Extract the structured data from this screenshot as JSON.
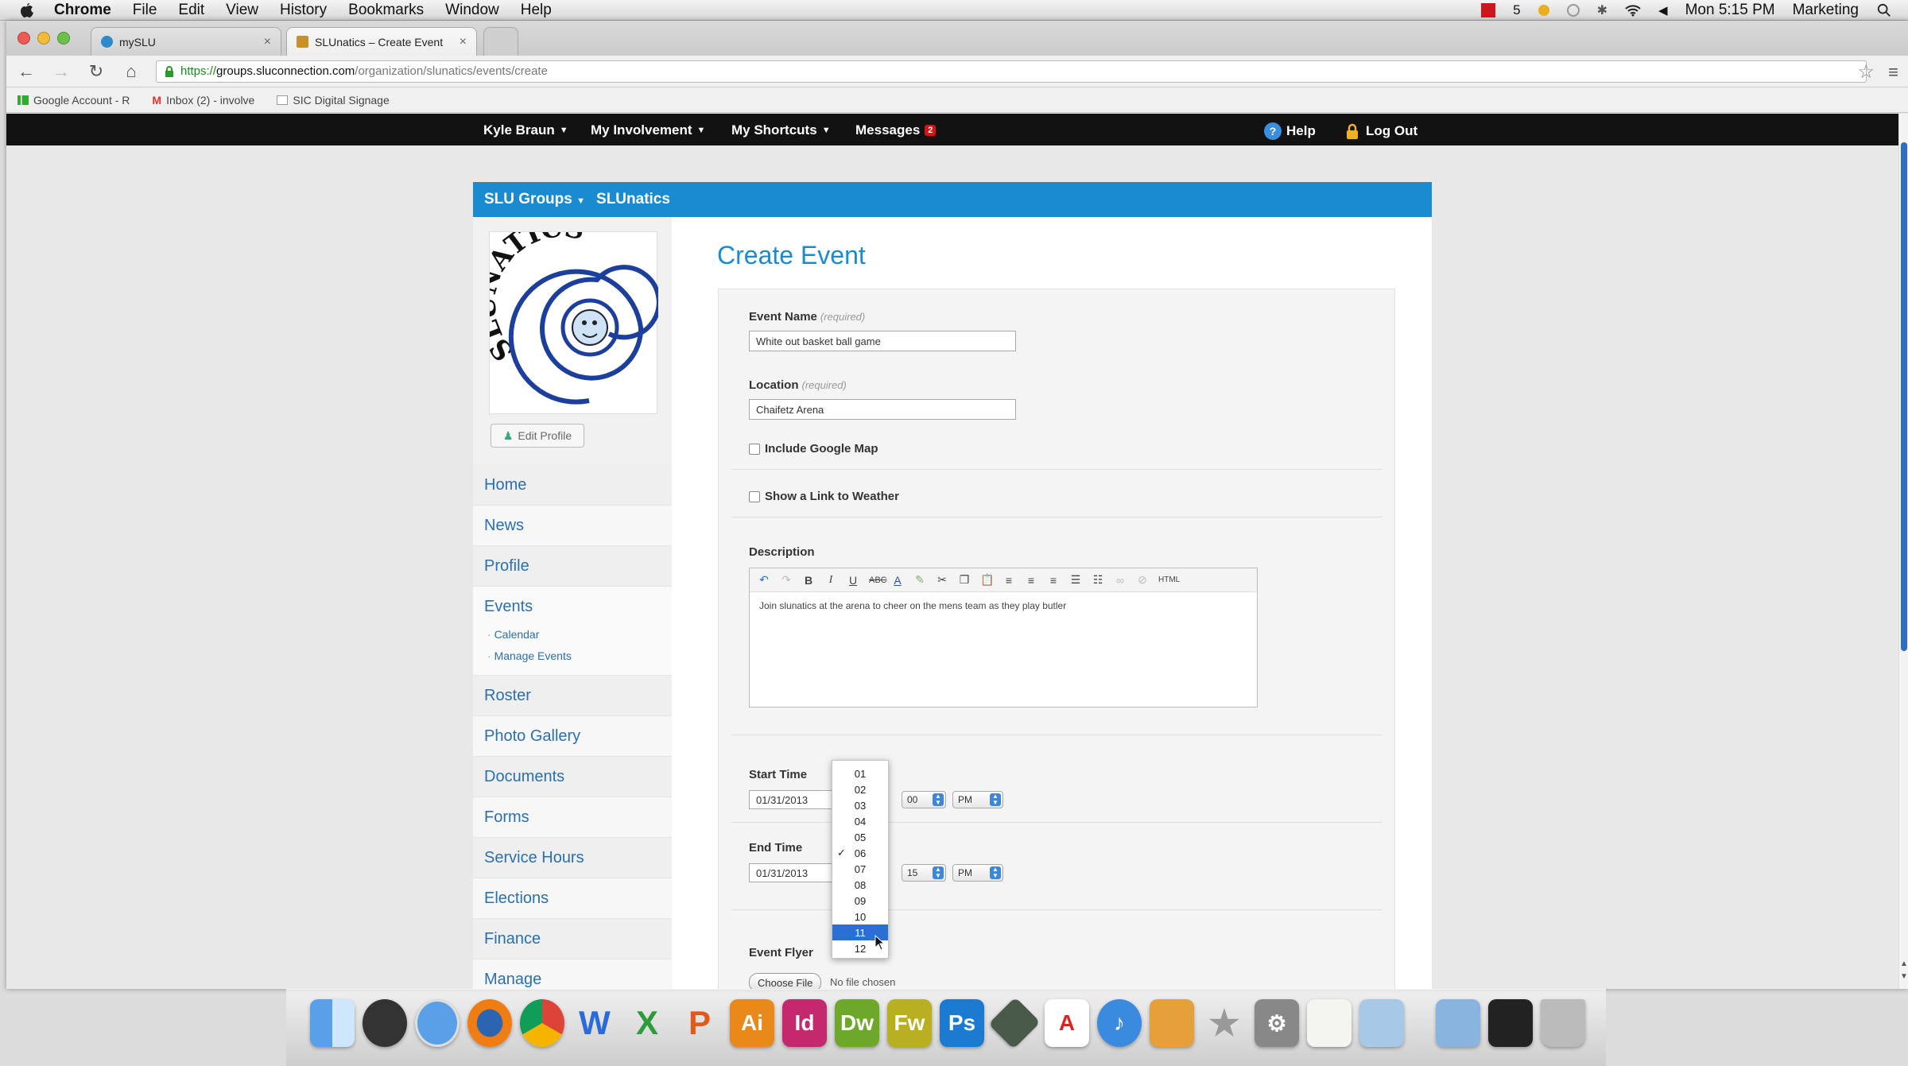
{
  "menubar": {
    "app": "Chrome",
    "items": [
      "File",
      "Edit",
      "View",
      "History",
      "Bookmarks",
      "Window",
      "Help"
    ],
    "status_text": "5",
    "clock": "Mon 5:15 PM",
    "user": "Marketing"
  },
  "browser": {
    "tabs": [
      {
        "title": "mySLU"
      },
      {
        "title": "SLUnatics – Create Event"
      }
    ],
    "url": {
      "scheme": "https://",
      "host": "groups.sluconnection.com",
      "path": "/organization/slunatics/events/create"
    },
    "bookmarks": [
      "Google Account - R",
      "Inbox (2) - involve",
      "SIC Digital Signage"
    ]
  },
  "topnav": {
    "user": "Kyle Braun",
    "involvement": "My Involvement",
    "shortcuts": "My Shortcuts",
    "messages": "Messages",
    "messages_count": "2",
    "help": "Help",
    "logout": "Log Out"
  },
  "groupbar": {
    "groups": "SLU Groups",
    "current": "SLUnatics"
  },
  "logo": {
    "text": "SLUNATICS"
  },
  "sidebar": {
    "edit_profile": "Edit Profile",
    "items": [
      {
        "label": "Home"
      },
      {
        "label": "News"
      },
      {
        "label": "Profile"
      },
      {
        "label": "Events"
      },
      {
        "label": "Roster"
      },
      {
        "label": "Photo Gallery"
      },
      {
        "label": "Documents"
      },
      {
        "label": "Forms"
      },
      {
        "label": "Service Hours"
      },
      {
        "label": "Elections"
      },
      {
        "label": "Finance"
      },
      {
        "label": "Manage"
      }
    ],
    "events_sub": [
      "Calendar",
      "Manage Events"
    ]
  },
  "form": {
    "title": "Create Event",
    "required_note": "(required)",
    "event_name_label": "Event Name",
    "event_name_value": "White out basket ball game",
    "location_label": "Location",
    "location_value": "Chaifetz Arena",
    "google_map_label": "Include Google Map",
    "weather_label": "Show a Link to Weather",
    "description_label": "Description",
    "description_value": "Join slunatics at the arena to cheer on the mens team as they play butler",
    "start_label": "Start Time",
    "start_date": "01/31/2013",
    "start_minute": "00",
    "start_ampm": "PM",
    "end_label": "End Time",
    "end_date": "01/31/2013",
    "end_minute": "15",
    "end_ampm": "PM",
    "flyer_label": "Event Flyer",
    "choose_file": "Choose File",
    "no_file": "No file chosen"
  },
  "hour_dropdown": {
    "options": [
      "01",
      "02",
      "03",
      "04",
      "05",
      "06",
      "07",
      "08",
      "09",
      "10",
      "11",
      "12"
    ],
    "checked": "06",
    "highlighted": "11"
  },
  "dock": {
    "apps": [
      "Finder",
      "Dashboard",
      "Safari",
      "Firefox",
      "Chrome",
      "W",
      "X",
      "P",
      "Ai",
      "Id",
      "Dw",
      "Fw",
      "Ps",
      "Monitor",
      "Acrobat",
      "iTunes",
      "iPhoto",
      "iMovie",
      "Preferences",
      "Notes",
      "Preview",
      "Folder",
      "Display",
      "Trash"
    ]
  },
  "colors": {
    "accent": "#1a8bd0",
    "nav_bg": "#121212",
    "link": "#2a6fb0",
    "highlight": "#2a6fd6"
  }
}
